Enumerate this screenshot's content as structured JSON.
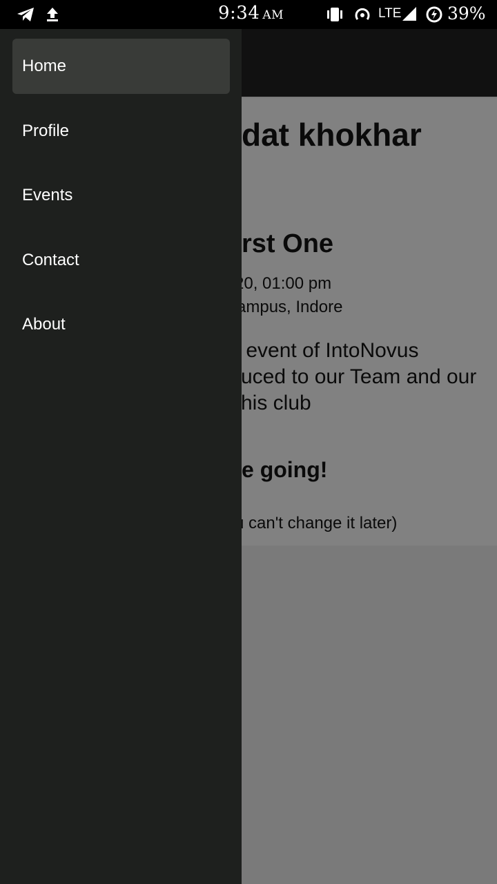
{
  "status_bar": {
    "time": "9:34",
    "ampm": "AM",
    "network": "LTE",
    "battery": "39%",
    "icons": [
      "telegram-icon",
      "upload-icon",
      "vibrate-icon",
      "hotspot-icon",
      "signal-icon",
      "battery-saver-icon"
    ]
  },
  "content": {
    "user_name_fragment": "dat khokhar",
    "event_title_fragment": "rst One",
    "event_datetime_fragment": "20, 01:00 pm",
    "event_location_fragment": "ampus, Indore",
    "description_lines": [
      "r event of IntoNovus",
      "uced to our Team and our",
      "his club"
    ],
    "going_fragment": "e going!",
    "note_fragment": "u can't change it later)"
  },
  "drawer": {
    "items": [
      {
        "label": "Home",
        "active": true
      },
      {
        "label": "Profile",
        "active": false
      },
      {
        "label": "Events",
        "active": false
      },
      {
        "label": "Contact",
        "active": false
      },
      {
        "label": "About",
        "active": false
      }
    ]
  },
  "colors": {
    "drawer_bg": "#1e201e",
    "active_item_bg": "#393b38",
    "toolbar_bg": "#111111",
    "scrim_content": "#818181"
  }
}
